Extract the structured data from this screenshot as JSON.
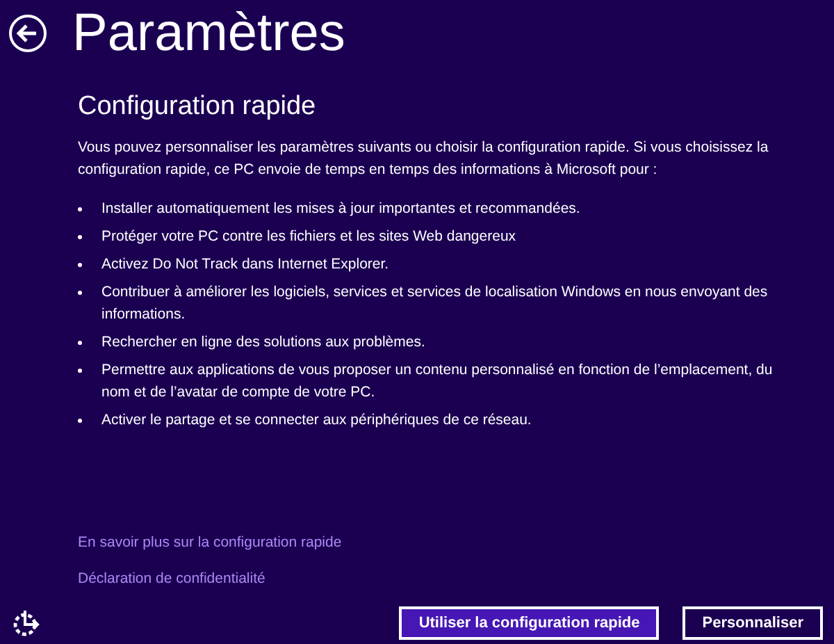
{
  "header": {
    "title": "Paramètres"
  },
  "section": {
    "heading": "Configuration rapide",
    "intro": "Vous pouvez personnaliser les paramètres suivants ou choisir la configuration rapide. Si vous choisissez la configuration rapide, ce PC envoie de temps en temps des informations à Microsoft pour :",
    "items": [
      "Installer automatiquement les mises à jour importantes et recommandées.",
      "Protéger votre PC contre les fichiers et les sites Web dangereux",
      "Activez Do Not Track dans Internet Explorer.",
      "Contribuer à améliorer les logiciels, services et services de localisation Windows en nous envoyant des informations.",
      "Rechercher en ligne des solutions aux problèmes.",
      "Permettre aux applications de vous proposer un contenu personnalisé en fonction de l’emplacement, du nom et de l’avatar de compte de votre PC.",
      "Activer le partage et se connecter aux périphériques de ce réseau."
    ]
  },
  "links": [
    "En savoir plus sur la configuration rapide",
    "Déclaration de confidentialité"
  ],
  "buttons": [
    {
      "label": "Utiliser la configuration rapide",
      "kind": "primary"
    },
    {
      "label": "Personnaliser",
      "kind": "secondary"
    }
  ]
}
